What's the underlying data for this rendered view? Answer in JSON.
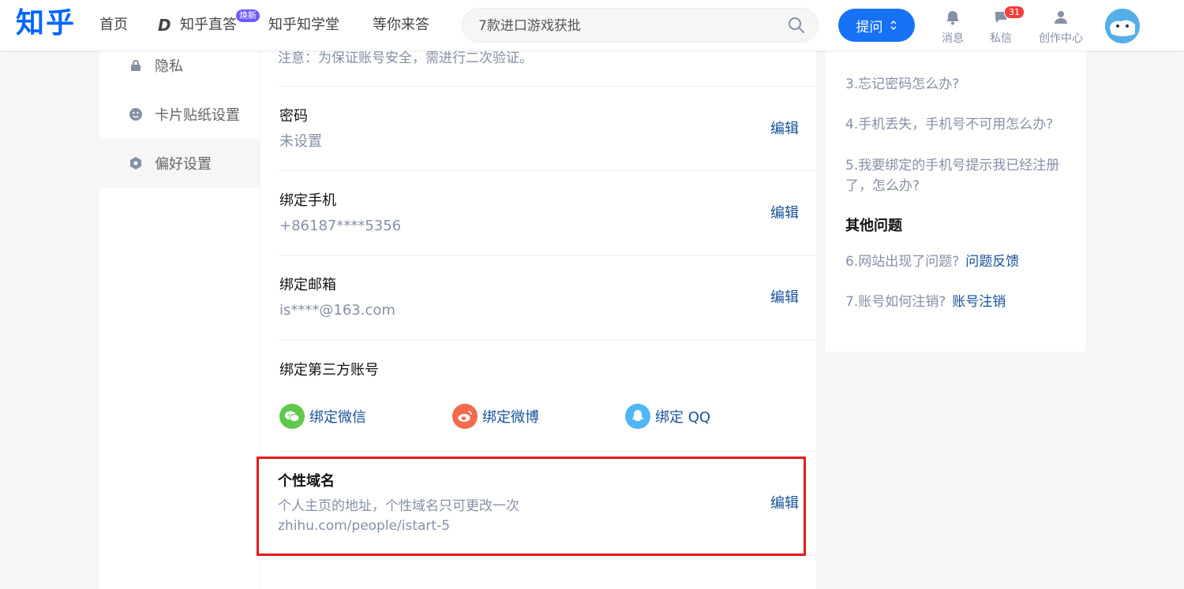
{
  "header": {
    "logo": "知乎",
    "nav": [
      "首页",
      "知乎直答",
      "知乎知学堂",
      "等你来答"
    ],
    "nav_badge": "焕新",
    "search_placeholder": "7款进口游戏获批",
    "ask_label": "提问",
    "tools": {
      "messages": "消息",
      "private_msg": "私信",
      "creator": "创作中心"
    },
    "private_msg_count": "31"
  },
  "sidebar": {
    "items": [
      {
        "label": "隐私",
        "icon": "lock-icon"
      },
      {
        "label": "卡片贴纸设置",
        "icon": "smile-icon"
      },
      {
        "label": "偏好设置",
        "icon": "hexagon-icon",
        "active": true
      }
    ]
  },
  "main": {
    "notice": "注意：为保证账号安全，需进行二次验证。",
    "password": {
      "title": "密码",
      "value": "未设置",
      "edit": "编辑"
    },
    "phone": {
      "title": "绑定手机",
      "value": "+86187****5356",
      "edit": "编辑"
    },
    "email": {
      "title": "绑定邮箱",
      "value": "is****@163.com",
      "edit": "编辑"
    },
    "third_party": {
      "title": "绑定第三方账号",
      "wechat": "绑定微信",
      "weibo": "绑定微博",
      "qq": "绑定 QQ"
    },
    "domain": {
      "title": "个性域名",
      "desc": "个人主页的地址，个性域名只可更改一次",
      "value": "zhihu.com/people/istart-5",
      "edit": "编辑"
    }
  },
  "right": {
    "faq3": "3.忘记密码怎么办?",
    "faq4": "4.手机丢失，手机号不可用怎么办?",
    "faq5": "5.我要绑定的手机号提示我已经注册了，怎么办?",
    "other_head": "其他问题",
    "faq6": "6.网站出现了问题?",
    "faq6_link": "问题反馈",
    "faq7": "7.账号如何注销?",
    "faq7_link": "账号注销"
  },
  "colors": {
    "brand": "#0066ff",
    "link": "#175199",
    "highlight": "#e5191c"
  }
}
